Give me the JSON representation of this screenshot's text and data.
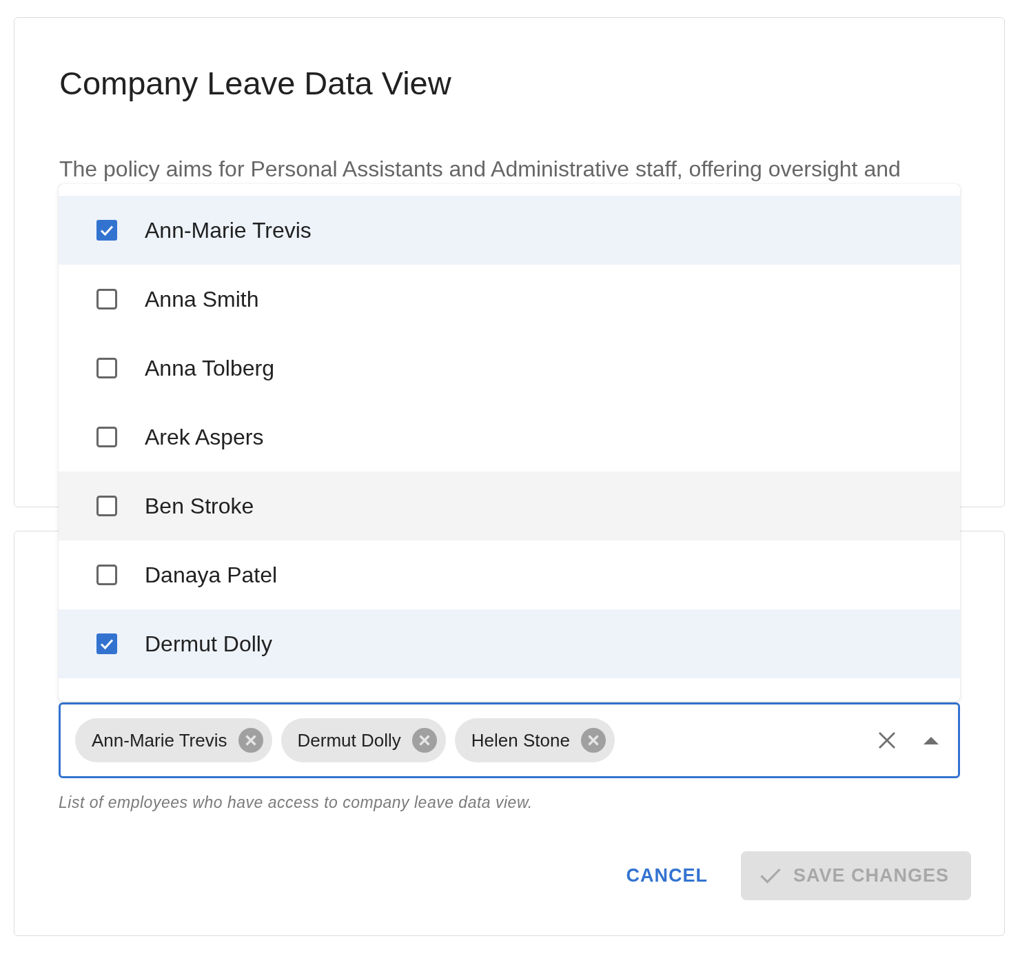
{
  "info_card": {
    "title": "Company Leave Data View",
    "description": "The policy aims for Personal Assistants and Administrative staff, offering oversight and"
  },
  "dropdown": {
    "options": [
      {
        "label": "Ann-Marie Trevis",
        "checked": true,
        "highlighted": false
      },
      {
        "label": "Anna Smith",
        "checked": false,
        "highlighted": false
      },
      {
        "label": "Anna Tolberg",
        "checked": false,
        "highlighted": false
      },
      {
        "label": "Arek Aspers",
        "checked": false,
        "highlighted": false
      },
      {
        "label": "Ben Stroke",
        "checked": false,
        "highlighted": true
      },
      {
        "label": "Danaya Patel",
        "checked": false,
        "highlighted": false
      },
      {
        "label": "Dermut Dolly",
        "checked": true,
        "highlighted": false
      }
    ]
  },
  "employees_field": {
    "chips": [
      "Ann-Marie Trevis",
      "Dermut Dolly",
      "Helen Stone"
    ],
    "focused": true,
    "expanded": true,
    "helper_text": "List of employees who have access to company leave data view."
  },
  "actions": [
    {
      "label": "CANCEL",
      "kind": "text",
      "disabled": false
    },
    {
      "label": "SAVE CHANGES",
      "kind": "contained",
      "disabled": true
    }
  ]
}
